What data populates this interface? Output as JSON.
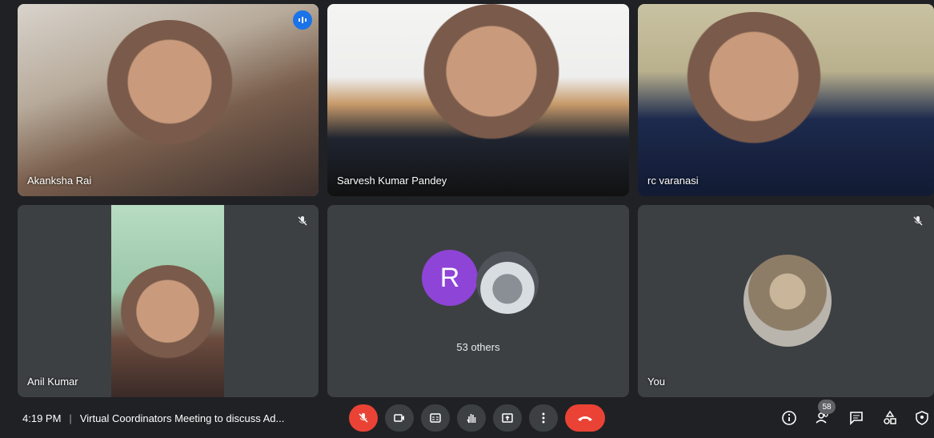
{
  "participants": [
    {
      "name": "Akanksha Rai",
      "speaking": true
    },
    {
      "name": "Sarvesh Kumar Pandey"
    },
    {
      "name": "rc varanasi"
    },
    {
      "name": "Anil Kumar",
      "muted": true
    },
    {
      "avatar_letter": "R",
      "others_label": "53 others",
      "muted": true
    },
    {
      "name": "You",
      "muted": true
    }
  ],
  "bottom_bar": {
    "time": "4:19 PM",
    "separator": "|",
    "meeting_title": "Virtual Coordinators Meeting to discuss Ad...",
    "people_count": "58"
  },
  "colors": {
    "background": "#202124",
    "tile": "#3c4043",
    "end_call": "#ea4335",
    "active_border": "#8ab4f8"
  },
  "icons": [
    "mic-off-icon",
    "camera-icon",
    "captions-icon",
    "raise-hand-icon",
    "present-icon",
    "more-options-icon",
    "end-call-icon",
    "info-icon",
    "people-icon",
    "chat-icon",
    "activities-icon",
    "host-controls-icon"
  ]
}
